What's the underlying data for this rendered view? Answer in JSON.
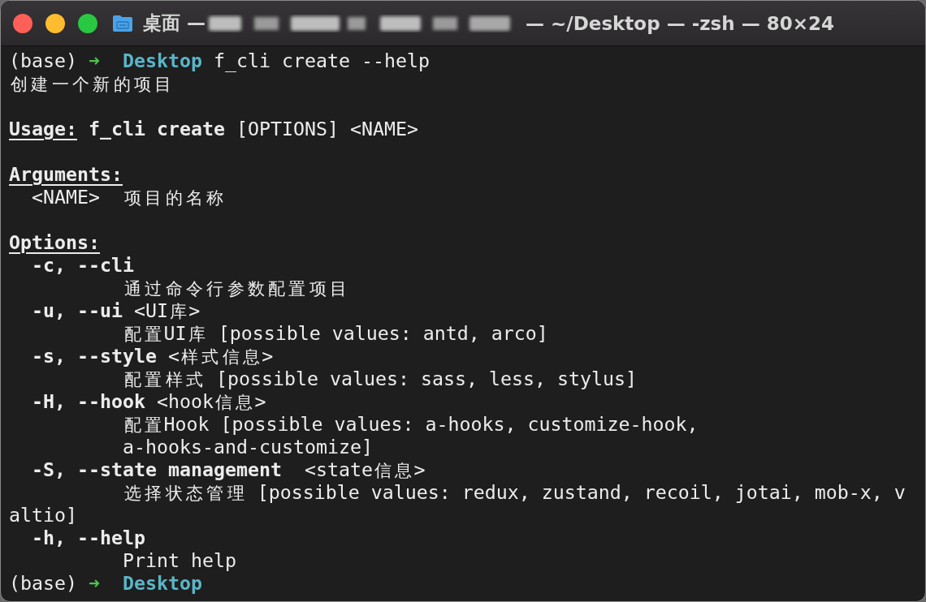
{
  "window": {
    "title_start": "桌面 —",
    "title_end": "— ~/Desktop — -zsh — 80×24",
    "redacted": true
  },
  "lines": [
    {
      "kind": "line",
      "segments": [
        {
          "kind": "text",
          "text": "(base) "
        },
        {
          "kind": "arrow",
          "text": "➜  "
        },
        {
          "kind": "dir",
          "text": "Desktop"
        },
        {
          "kind": "text",
          "text": " f_cli create --help"
        }
      ]
    },
    {
      "kind": "line",
      "segments": [
        {
          "kind": "text",
          "text": "创建一个新的项目"
        }
      ]
    },
    {
      "kind": "blank"
    },
    {
      "kind": "line",
      "segments": [
        {
          "kind": "heading",
          "text": "Usage:"
        },
        {
          "kind": "bold",
          "text": " f_cli create"
        },
        {
          "kind": "text",
          "text": " [OPTIONS] <NAME>"
        }
      ]
    },
    {
      "kind": "blank"
    },
    {
      "kind": "line",
      "segments": [
        {
          "kind": "heading",
          "text": "Arguments:"
        }
      ]
    },
    {
      "kind": "line",
      "segments": [
        {
          "kind": "text",
          "text": "  <NAME>  项目的名称"
        }
      ]
    },
    {
      "kind": "blank"
    },
    {
      "kind": "line",
      "segments": [
        {
          "kind": "heading",
          "text": "Options:"
        }
      ]
    },
    {
      "kind": "line",
      "segments": [
        {
          "kind": "bold",
          "text": "  -c, --cli"
        }
      ]
    },
    {
      "kind": "line",
      "segments": [
        {
          "kind": "text",
          "text": "          通过命令行参数配置项目"
        }
      ]
    },
    {
      "kind": "line",
      "segments": [
        {
          "kind": "bold",
          "text": "  -u, --ui"
        },
        {
          "kind": "text",
          "text": " <UI库>"
        }
      ]
    },
    {
      "kind": "line",
      "segments": [
        {
          "kind": "text",
          "text": "          配置UI库 [possible values: antd, arco]"
        }
      ]
    },
    {
      "kind": "line",
      "segments": [
        {
          "kind": "bold",
          "text": "  -s, --style"
        },
        {
          "kind": "text",
          "text": " <样式信息>"
        }
      ]
    },
    {
      "kind": "line",
      "segments": [
        {
          "kind": "text",
          "text": "          配置样式 [possible values: sass, less, stylus]"
        }
      ]
    },
    {
      "kind": "line",
      "segments": [
        {
          "kind": "bold",
          "text": "  -H, --hook"
        },
        {
          "kind": "text",
          "text": " <hook信息>"
        }
      ]
    },
    {
      "kind": "line",
      "segments": [
        {
          "kind": "text",
          "text": "          配置Hook [possible values: a-hooks, customize-hook,"
        }
      ]
    },
    {
      "kind": "line",
      "segments": [
        {
          "kind": "text",
          "text": "          a-hooks-and-customize]"
        }
      ]
    },
    {
      "kind": "line",
      "segments": [
        {
          "kind": "bold",
          "text": "  -S, --state management"
        },
        {
          "kind": "text",
          "text": "  <state信息>"
        }
      ]
    },
    {
      "kind": "line",
      "segments": [
        {
          "kind": "text",
          "text": "          选择状态管理 [possible values: redux, zustand, recoil, jotai, mob-x, v"
        }
      ]
    },
    {
      "kind": "line",
      "segments": [
        {
          "kind": "text",
          "text": "altio]"
        }
      ]
    },
    {
      "kind": "line",
      "segments": [
        {
          "kind": "bold",
          "text": "  -h, --help"
        }
      ]
    },
    {
      "kind": "line",
      "segments": [
        {
          "kind": "text",
          "text": "          Print help"
        }
      ]
    },
    {
      "kind": "line",
      "segments": [
        {
          "kind": "text",
          "text": "(base) "
        },
        {
          "kind": "arrow",
          "text": "➜  "
        },
        {
          "kind": "dir",
          "text": "Desktop"
        }
      ]
    }
  ]
}
